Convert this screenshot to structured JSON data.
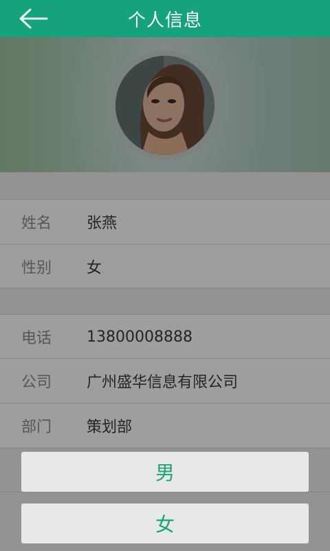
{
  "header": {
    "title": "个人信息",
    "back_icon": "arrow-left-icon"
  },
  "profile": {
    "rows1": [
      {
        "label": "姓名",
        "value": "张燕"
      },
      {
        "label": "性别",
        "value": "女"
      }
    ],
    "rows2": [
      {
        "label": "电话",
        "value": "13800008888"
      },
      {
        "label": "公司",
        "value": "广州盛华信息有限公司"
      },
      {
        "label": "部门",
        "value": "策划部"
      }
    ]
  },
  "gender_sheet": {
    "option_male": "男",
    "option_female": "女"
  },
  "colors": {
    "brand": "#14a37a",
    "option_text": "#18a37a",
    "overlay": "rgba(0,0,0,0.38)"
  }
}
